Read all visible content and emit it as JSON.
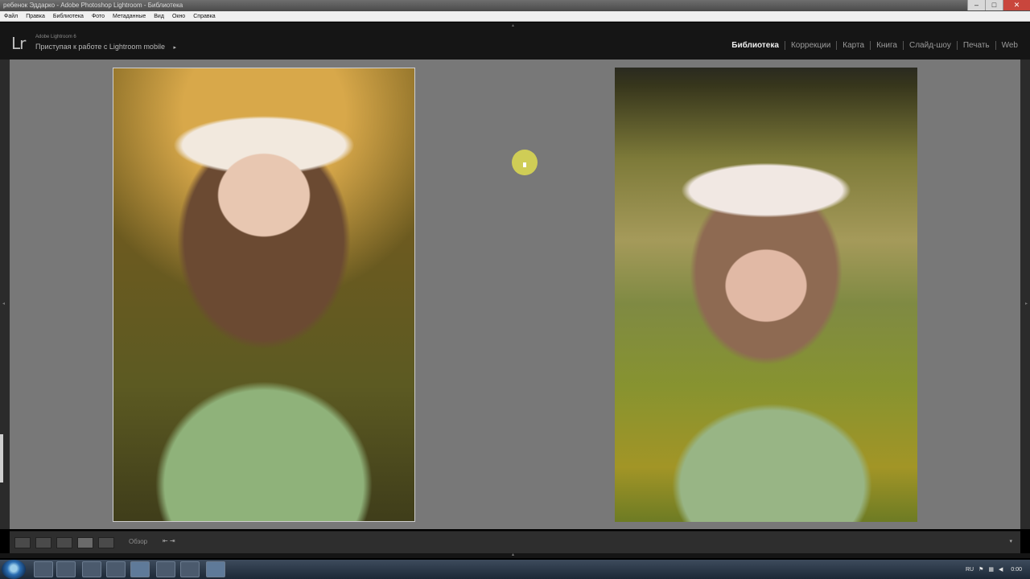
{
  "window": {
    "title": "ребенок Эддарко - Adobe Photoshop Lightroom - Библиотека",
    "min": "–",
    "max": "□",
    "close": "✕"
  },
  "menu": [
    "Файл",
    "Правка",
    "Библиотека",
    "Фото",
    "Метаданные",
    "Вид",
    "Окно",
    "Справка"
  ],
  "identity": {
    "logo": "Lr",
    "product": "Adobe Lightroom 6",
    "mobile": "Приступая к работе с Lightroom mobile",
    "mobile_arrow": "▸"
  },
  "modules": [
    "Библиотека",
    "Коррекции",
    "Карта",
    "Книга",
    "Слайд-шоу",
    "Печать",
    "Web"
  ],
  "active_module": "Библиотека",
  "toolbar": {
    "label": "Обзор",
    "swap": "⇤ ⇥",
    "down": "▾"
  },
  "taskbar": {
    "lang": "RU",
    "clock": "0:00"
  },
  "colors": {
    "canvas": "#787878",
    "panel": "#2e2e2e",
    "accent": "#dedc50"
  }
}
